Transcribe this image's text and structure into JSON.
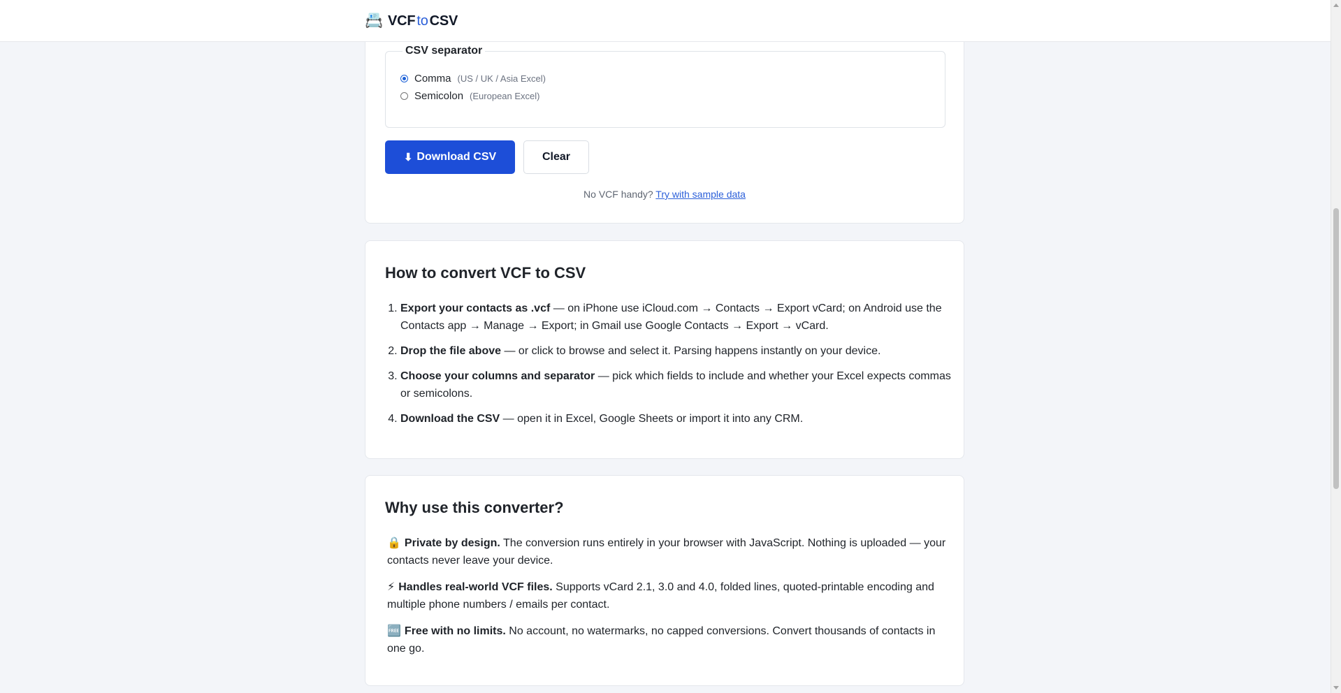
{
  "header": {
    "logo_emoji": "📇",
    "logo_part1": "VCF",
    "logo_part2": "to",
    "logo_part3": "CSV"
  },
  "converter": {
    "separator_legend": "CSV separator",
    "options": [
      {
        "label": "Comma",
        "hint": "(US / UK / Asia Excel)",
        "checked": true
      },
      {
        "label": "Semicolon",
        "hint": "(European Excel)",
        "checked": false
      }
    ],
    "download_icon": "⬇",
    "download_label": "Download CSV",
    "clear_label": "Clear",
    "sample_prefix": "No VCF handy?",
    "sample_link": "Try with sample data"
  },
  "how": {
    "title": "How to convert VCF to CSV",
    "steps": [
      {
        "bold": "Export your contacts as .vcf",
        "text": " — on iPhone use iCloud.com → Contacts → Export vCard; on Android use the Contacts app → Manage → Export; in Gmail use Google Contacts → Export → vCard."
      },
      {
        "bold": "Drop the file above",
        "text": " — or click to browse and select it. Parsing happens instantly on your device."
      },
      {
        "bold": "Choose your columns and separator",
        "text": " — pick which fields to include and whether your Excel expects commas or semicolons."
      },
      {
        "bold": "Download the CSV",
        "text": " — open it in Excel, Google Sheets or import it into any CRM."
      }
    ]
  },
  "why": {
    "title": "Why use this converter?",
    "items": [
      {
        "icon": "🔒",
        "bold": "Private by design.",
        "text": " The conversion runs entirely in your browser with JavaScript. Nothing is uploaded — your contacts never leave your device."
      },
      {
        "icon": "⚡",
        "bold": "Handles real-world VCF files.",
        "text": " Supports vCard 2.1, 3.0 and 4.0, folded lines, quoted-printable encoding and multiple phone numbers / emails per contact."
      },
      {
        "icon": "🆓",
        "bold": "Free with no limits.",
        "text": " No account, no watermarks, no capped conversions. Convert thousands of contacts in one go."
      }
    ]
  },
  "colors": {
    "accent": "#1d4ed8",
    "link": "#2b5fd9",
    "background": "#f3f5f9"
  }
}
